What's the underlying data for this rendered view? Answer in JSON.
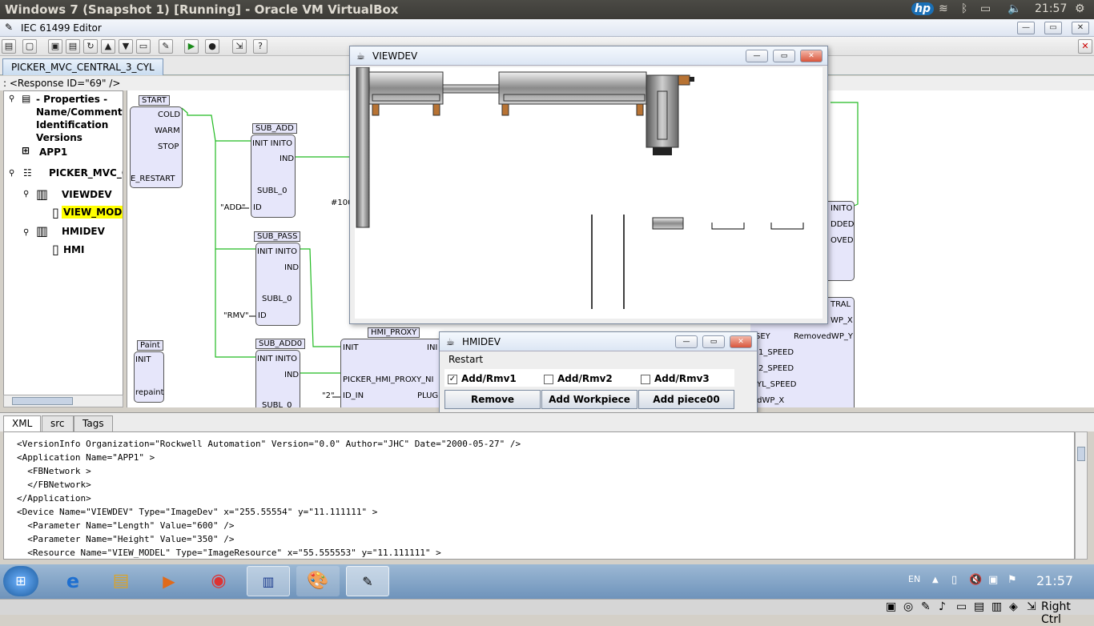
{
  "topbar": {
    "title": "Windows 7 (Snapshot 1) [Running] - Oracle VM VirtualBox",
    "clock": "21:57",
    "brand": "hp"
  },
  "editor": {
    "title": "IEC 61499 Editor",
    "tab": "PICKER_MVC_CENTRAL_3_CYL",
    "response": ": <Response ID=\"69\" />"
  },
  "tree": {
    "properties": "- Properties -",
    "name_comment": "Name/Comment",
    "identification": "Identification",
    "versions": "Versions",
    "app1": "APP1",
    "system": "PICKER_MVC_C",
    "viewdev": "VIEWDEV",
    "view_model": "VIEW_MODE",
    "hmidev": "HMIDEV",
    "hmi": "HMI"
  },
  "diagram": {
    "start": {
      "name": "START",
      "cold": "COLD",
      "warm": "WARM",
      "stop": "STOP",
      "e_restart": "E_RESTART"
    },
    "sub_add": {
      "name": "SUB_ADD",
      "io": "INIT INITO",
      "ind": "IND",
      "subl": "SUBL_0",
      "id": "ID",
      "const": "\"ADD\""
    },
    "sub_pass": {
      "name": "SUB_PASS",
      "io": "INIT INITO",
      "ind": "IND",
      "subl": "SUBL_0",
      "id": "ID",
      "const": "\"RMV\""
    },
    "sub_add0": {
      "name": "SUB_ADD0",
      "io": "INIT INITO",
      "ind": "IND",
      "subl": "SUBL_0"
    },
    "paint": {
      "name": "Paint",
      "init": "INIT",
      "repaint": "repaint"
    },
    "hmi_proxy": {
      "name": "HMI_PROXY",
      "init": "INIT",
      "inito": "INI",
      "pname": "PICKER_HMI_PROXY_NI",
      "id_in": "ID_IN",
      "plug": "PLUG",
      "const": "\"2\""
    },
    "hash_const": "#100",
    "right_block": {
      "inito": "INITO",
      "added": "DDED",
      "moved": "OVED"
    },
    "central_block": {
      "tral": "TRAL",
      "wp_x": "WP_X",
      "sey": "SEY",
      "removed_wp_y": "RemovedWP_Y",
      "speed1": "1_SPEED",
      "speed2": "2_SPEED",
      "cyl_speed": "YL_SPEED",
      "edwp_x": "edWP_X"
    }
  },
  "viewdev": {
    "title": "VIEWDEV"
  },
  "hmidev": {
    "title": "HMIDEV",
    "restart": "Restart",
    "checks": [
      {
        "label": "Add/Rmv1",
        "checked": true
      },
      {
        "label": "Add/Rmv2",
        "checked": false
      },
      {
        "label": "Add/Rmv3",
        "checked": false
      }
    ],
    "buttons": {
      "remove": "Remove Workpiece",
      "add": "Add Workpiece",
      "add_piece": "Add piece00"
    }
  },
  "bottom": {
    "tabs": [
      "XML",
      "src",
      "Tags"
    ],
    "xml": [
      "<VersionInfo Organization=\"Rockwell Automation\" Version=\"0.0\" Author=\"JHC\" Date=\"2000-05-27\" />",
      "<Application Name=\"APP1\" >",
      "  <FBNetwork >",
      "  </FBNetwork>",
      "</Application>",
      "<Device Name=\"VIEWDEV\" Type=\"ImageDev\" x=\"255.55554\" y=\"11.111111\" >",
      "  <Parameter Name=\"Length\" Value=\"600\" />",
      "  <Parameter Name=\"Height\" Value=\"350\" />",
      "  <Resource Name=\"VIEW_MODEL\" Type=\"ImageResource\" x=\"55.555553\" y=\"11.111111\" >"
    ]
  },
  "taskbar": {
    "lang": "EN",
    "clock": "21:57"
  },
  "vbox_status": {
    "hostkey": "Right Ctrl"
  },
  "colors": {
    "fb_fill": "#e6e6fa",
    "wire": "#22bb22",
    "highlight": "#ffff00",
    "titlebar": "#3c3b37"
  }
}
